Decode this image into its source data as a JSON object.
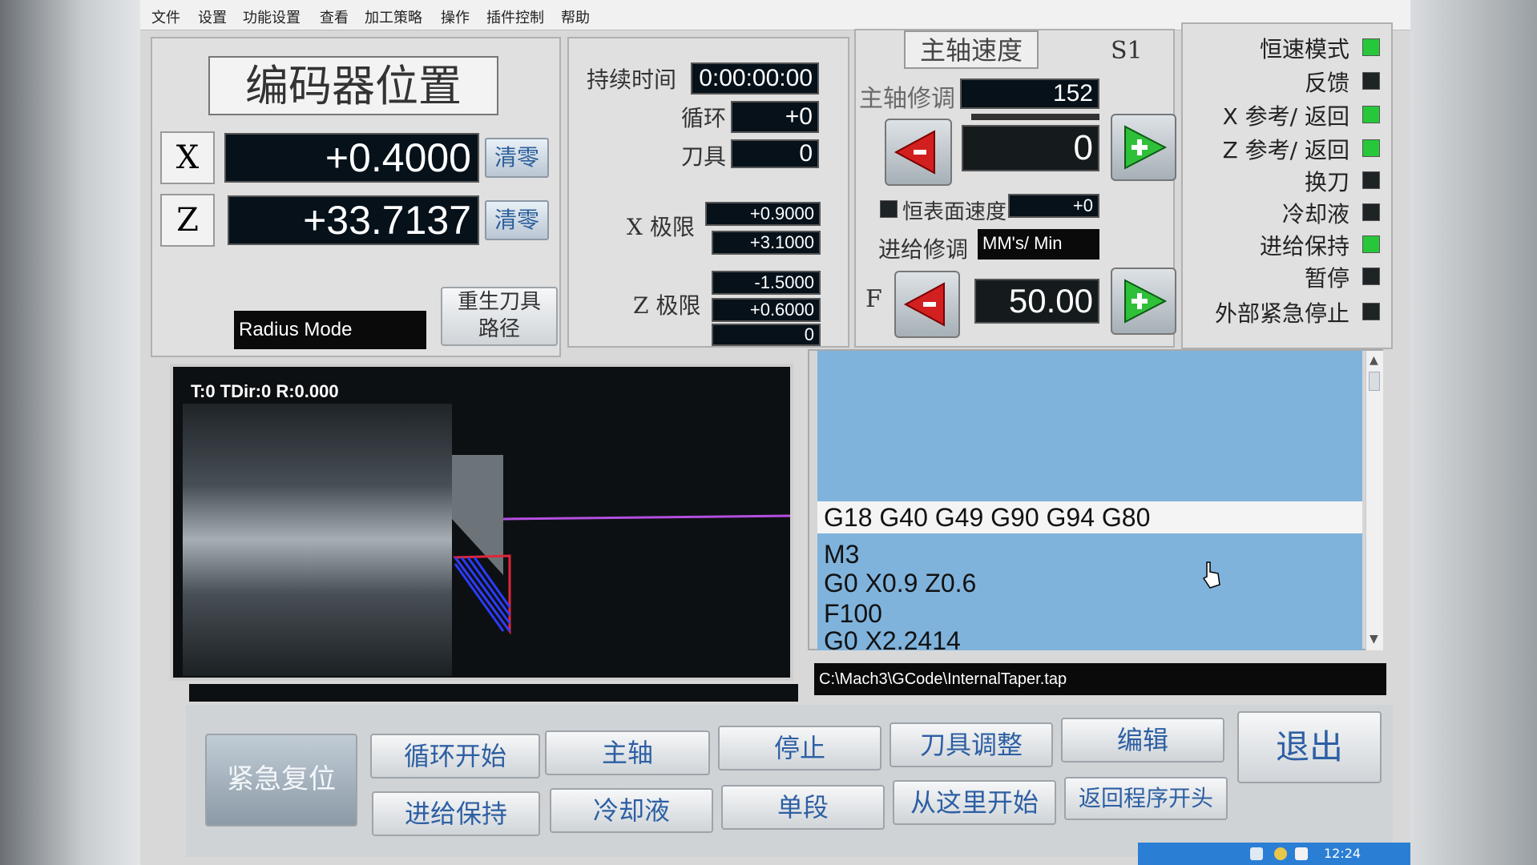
{
  "menu": [
    "文件",
    "设置",
    "功能设置",
    "查看",
    "加工策略",
    "操作",
    "插件控制",
    "帮助"
  ],
  "encoder": {
    "title": "编码器位置",
    "x_label": "X",
    "x_value": "+0.4000",
    "z_label": "Z",
    "z_value": "+33.7137",
    "zero_label": "清零",
    "mode": "Radius Mode",
    "regen_label_1": "重生刀具",
    "regen_label_2": "路径"
  },
  "run": {
    "duration_label": "持续时间",
    "duration_value": "0:00:00:00",
    "cycle_label": "循环",
    "cycle_value": "+0",
    "tool_label": "刀具",
    "tool_value": "0",
    "xlimit_label": "X 极限",
    "xlimit_min": "+0.9000",
    "xlimit_max": "+3.1000",
    "zlimit_label": "Z 极限",
    "zlimit_min": "-1.5000",
    "zlimit_max": "+0.6000",
    "extra_value": "0"
  },
  "spindle": {
    "title": "主轴速度",
    "s_label": "S1",
    "override_label": "主轴修调",
    "override_value": "152",
    "speed_value": "0",
    "css_label": "恒表面速度",
    "css_value": "+0",
    "feed_override_label": "进给修调",
    "feed_units": "MM's/ Min",
    "f_label": "F",
    "f_value": "50.00"
  },
  "status": [
    {
      "label": "恒速模式",
      "on": true
    },
    {
      "label": "反馈",
      "on": false
    },
    {
      "label": "X 参考/ 返回",
      "on": true
    },
    {
      "label": "Z 参考/ 返回",
      "on": true
    },
    {
      "label": "换刀",
      "on": false
    },
    {
      "label": "冷却液",
      "on": false
    },
    {
      "label": "进给保持",
      "on": true
    },
    {
      "label": "暂停",
      "on": false
    },
    {
      "label": "外部紧急停止",
      "on": false
    }
  ],
  "toolpath": {
    "info": "T:0 TDir:0 R:0.000"
  },
  "gcode": {
    "current_line": "G18 G40 G49 G90 G94 G80",
    "lines": [
      "M3",
      "G0 X0.9 Z0.6",
      "F100",
      "G0 X2.2414"
    ],
    "file_path": "C:\\Mach3\\GCode\\InternalTaper.tap"
  },
  "buttons": {
    "reset": "紧急复位",
    "cycle_start": "循环开始",
    "spindle": "主轴",
    "stop": "停止",
    "tool_adjust": "刀具调整",
    "edit": "编辑",
    "exit": "退出",
    "feed_hold": "进给保持",
    "coolant": "冷却液",
    "single_block": "单段",
    "run_from_here": "从这里开始",
    "rewind": "返回程序开头"
  },
  "taskbar": {
    "time": "12:24"
  },
  "colors": {
    "led_on": "#26c73a",
    "led_off": "#1e2326",
    "gcode_bg": "#7fb3dc",
    "lcd_bg": "#06111a"
  }
}
